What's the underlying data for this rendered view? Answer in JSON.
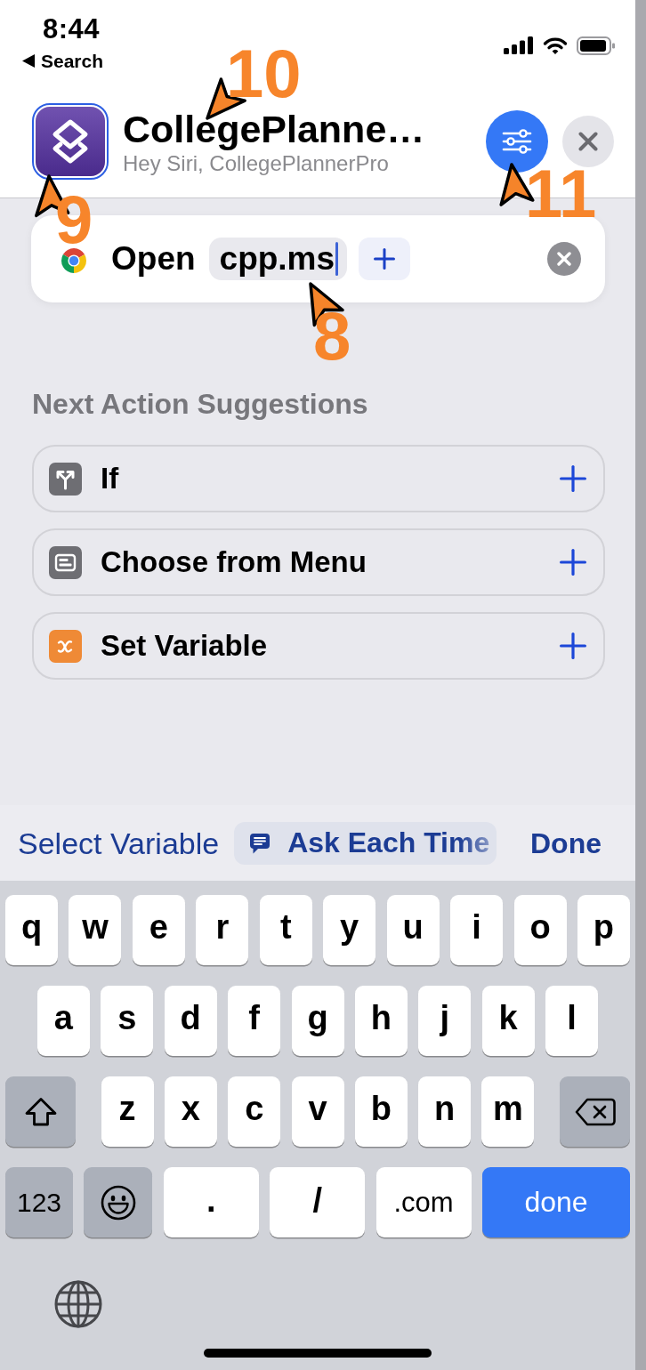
{
  "status_bar": {
    "time": "8:44",
    "back_label": "Search"
  },
  "header": {
    "app_icon": {
      "highlighted": true
    },
    "title": "CollegePlanne…",
    "subtitle": "Hey Siri, CollegePlannerPro"
  },
  "action": {
    "verb": "Open",
    "token": {
      "text": "cpp.ms",
      "editing": true
    }
  },
  "suggestions": {
    "title": "Next Action Suggestions",
    "items": [
      {
        "kind": "if",
        "label": "If"
      },
      {
        "kind": "menu",
        "label": "Choose from Menu"
      },
      {
        "kind": "variable",
        "label": "Set Variable"
      }
    ]
  },
  "variable_bar": {
    "select_label": "Select Variable",
    "ask_label": "Ask Each Time",
    "done_label": "Done"
  },
  "keyboard": {
    "rows": [
      {
        "keys": [
          {
            "kind": "letter",
            "label": "q"
          },
          {
            "kind": "letter",
            "label": "w"
          },
          {
            "kind": "letter",
            "label": "e"
          },
          {
            "kind": "letter",
            "label": "r"
          },
          {
            "kind": "letter",
            "label": "t"
          },
          {
            "kind": "letter",
            "label": "y"
          },
          {
            "kind": "letter",
            "label": "u"
          },
          {
            "kind": "letter",
            "label": "i"
          },
          {
            "kind": "letter",
            "label": "o"
          },
          {
            "kind": "letter",
            "label": "p"
          }
        ]
      },
      {
        "keys": [
          {
            "kind": "letter",
            "label": "a"
          },
          {
            "kind": "letter",
            "label": "s"
          },
          {
            "kind": "letter",
            "label": "d"
          },
          {
            "kind": "letter",
            "label": "f"
          },
          {
            "kind": "letter",
            "label": "g"
          },
          {
            "kind": "letter",
            "label": "h"
          },
          {
            "kind": "letter",
            "label": "j"
          },
          {
            "kind": "letter",
            "label": "k"
          },
          {
            "kind": "letter",
            "label": "l"
          }
        ]
      },
      {
        "keys": [
          {
            "kind": "shift"
          },
          {
            "kind": "letter",
            "label": "z"
          },
          {
            "kind": "letter",
            "label": "x"
          },
          {
            "kind": "letter",
            "label": "c"
          },
          {
            "kind": "letter",
            "label": "v"
          },
          {
            "kind": "letter",
            "label": "b"
          },
          {
            "kind": "letter",
            "label": "n"
          },
          {
            "kind": "letter",
            "label": "m"
          },
          {
            "kind": "delete"
          }
        ]
      },
      {
        "keys": [
          {
            "kind": "mode",
            "label": "123"
          },
          {
            "kind": "emoji"
          },
          {
            "kind": "symbol",
            "label": "."
          },
          {
            "kind": "symbol",
            "label": "/"
          },
          {
            "kind": "symbol",
            "label": ".com"
          },
          {
            "kind": "return",
            "label": "done"
          }
        ]
      }
    ]
  },
  "callouts": [
    {
      "number": "10",
      "kind": "title"
    },
    {
      "number": "9",
      "kind": "icon"
    },
    {
      "number": "11",
      "kind": "settings"
    },
    {
      "number": "8",
      "kind": "token"
    }
  ]
}
